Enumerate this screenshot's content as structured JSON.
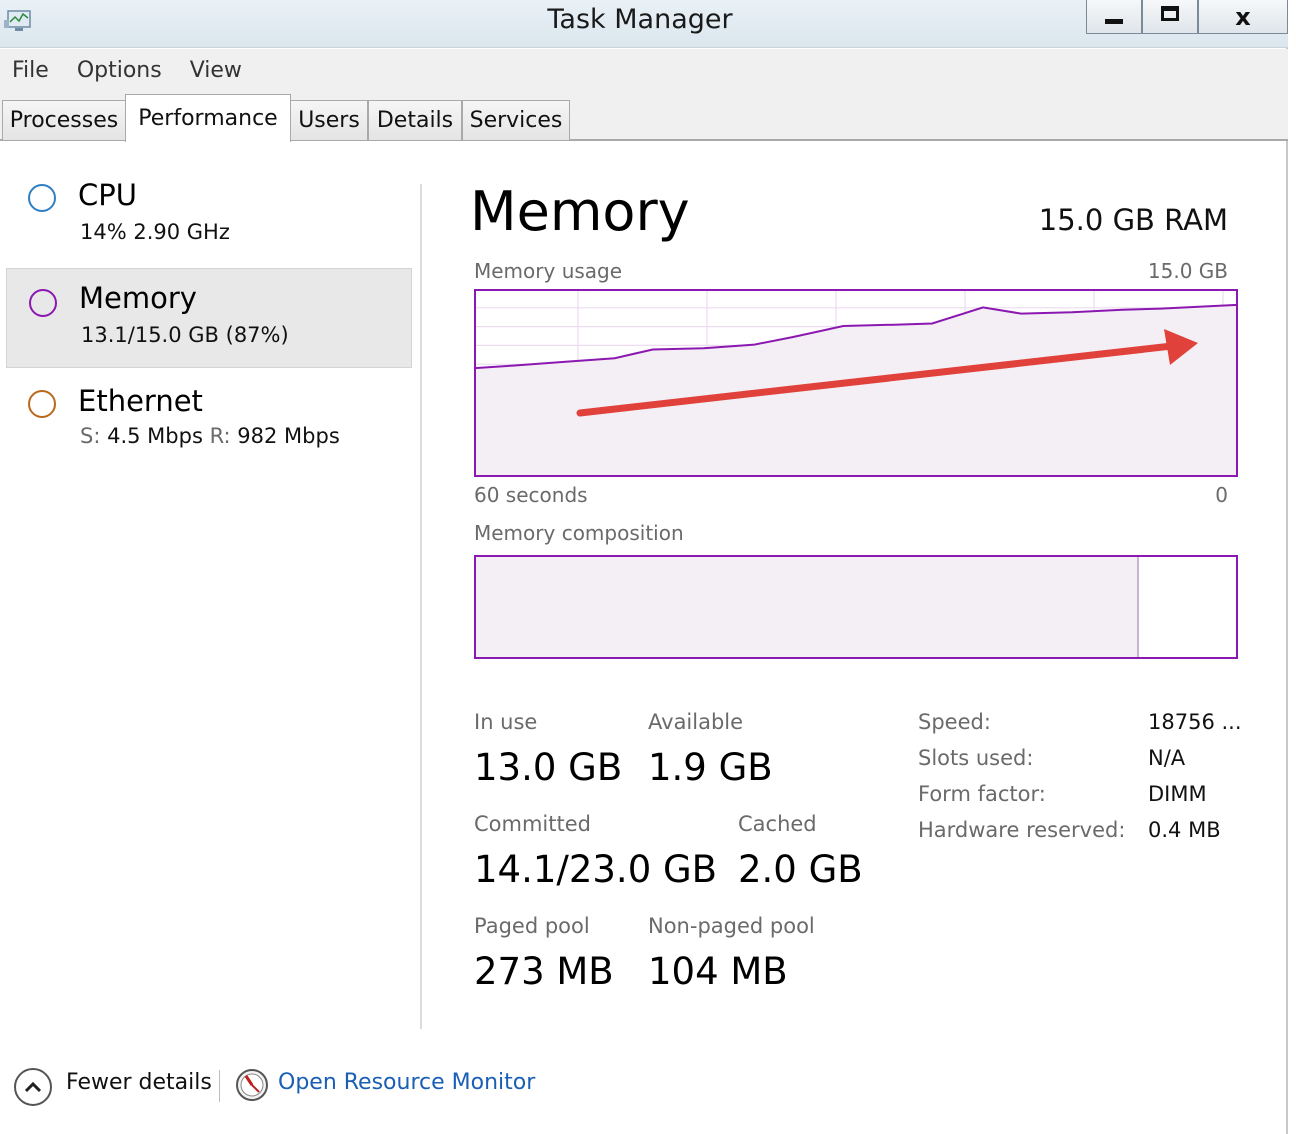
{
  "window": {
    "title": "Task Manager",
    "app_icon": "task-manager-icon",
    "controls": {
      "minimize": "minimize-icon",
      "maximize": "maximize-icon",
      "close_label": "x"
    }
  },
  "menu": [
    "File",
    "Options",
    "View"
  ],
  "tabs": [
    "Processes",
    "Performance",
    "Users",
    "Details",
    "Services"
  ],
  "active_tab": "Performance",
  "resources": [
    {
      "name": "CPU",
      "line": "14%  2.90 GHz",
      "color": "#2f7fc4"
    },
    {
      "name": "Memory",
      "line": "13.1/15.0 GB (87%)",
      "color": "#8b18b0"
    },
    {
      "name": "Ethernet",
      "s_key": "S:",
      "s_val": "4.5 Mbps",
      "r_key": "R:",
      "r_val": "982 Mbps",
      "color": "#b86a1b"
    }
  ],
  "panel": {
    "title": "Memory",
    "total": "15.0 GB RAM",
    "usage_label": "Memory usage",
    "usage_max": "15.0 GB",
    "time_left": "60 seconds",
    "time_right": "0",
    "composition_label": "Memory composition",
    "composition_in_use_fraction": 0.873,
    "accent_color": "#8b18b0",
    "annotation_arrow_color": "#e0413a"
  },
  "chart_data": {
    "type": "area",
    "x": [
      60,
      57,
      53,
      49,
      46,
      42,
      38,
      35,
      31,
      27,
      24,
      20,
      17,
      13,
      9,
      6,
      2,
      0
    ],
    "values": [
      8.7,
      8.9,
      9.2,
      9.5,
      10.2,
      10.3,
      10.6,
      11.2,
      12.1,
      12.2,
      12.3,
      13.6,
      13.1,
      13.2,
      13.4,
      13.5,
      13.7,
      13.8
    ],
    "xlabel": "",
    "ylabel": "",
    "xlim": [
      60,
      0
    ],
    "ylim": [
      0,
      15.0
    ],
    "grid": true
  },
  "stats": {
    "in_use_label": "In use",
    "in_use": "13.0 GB",
    "available_label": "Available",
    "available": "1.9 GB",
    "committed_label": "Committed",
    "committed": "14.1/23.0 GB",
    "cached_label": "Cached",
    "cached": "2.0 GB",
    "paged_label": "Paged pool",
    "paged": "273 MB",
    "nonpaged_label": "Non-paged pool",
    "nonpaged": "104 MB"
  },
  "specs": [
    {
      "label": "Speed:",
      "value": "18756 ..."
    },
    {
      "label": "Slots used:",
      "value": "N/A"
    },
    {
      "label": "Form factor:",
      "value": "DIMM"
    },
    {
      "label": "Hardware reserved:",
      "value": "0.4 MB"
    }
  ],
  "footer": {
    "fewer_details": "Fewer details",
    "open_resource_monitor": "Open Resource Monitor"
  }
}
